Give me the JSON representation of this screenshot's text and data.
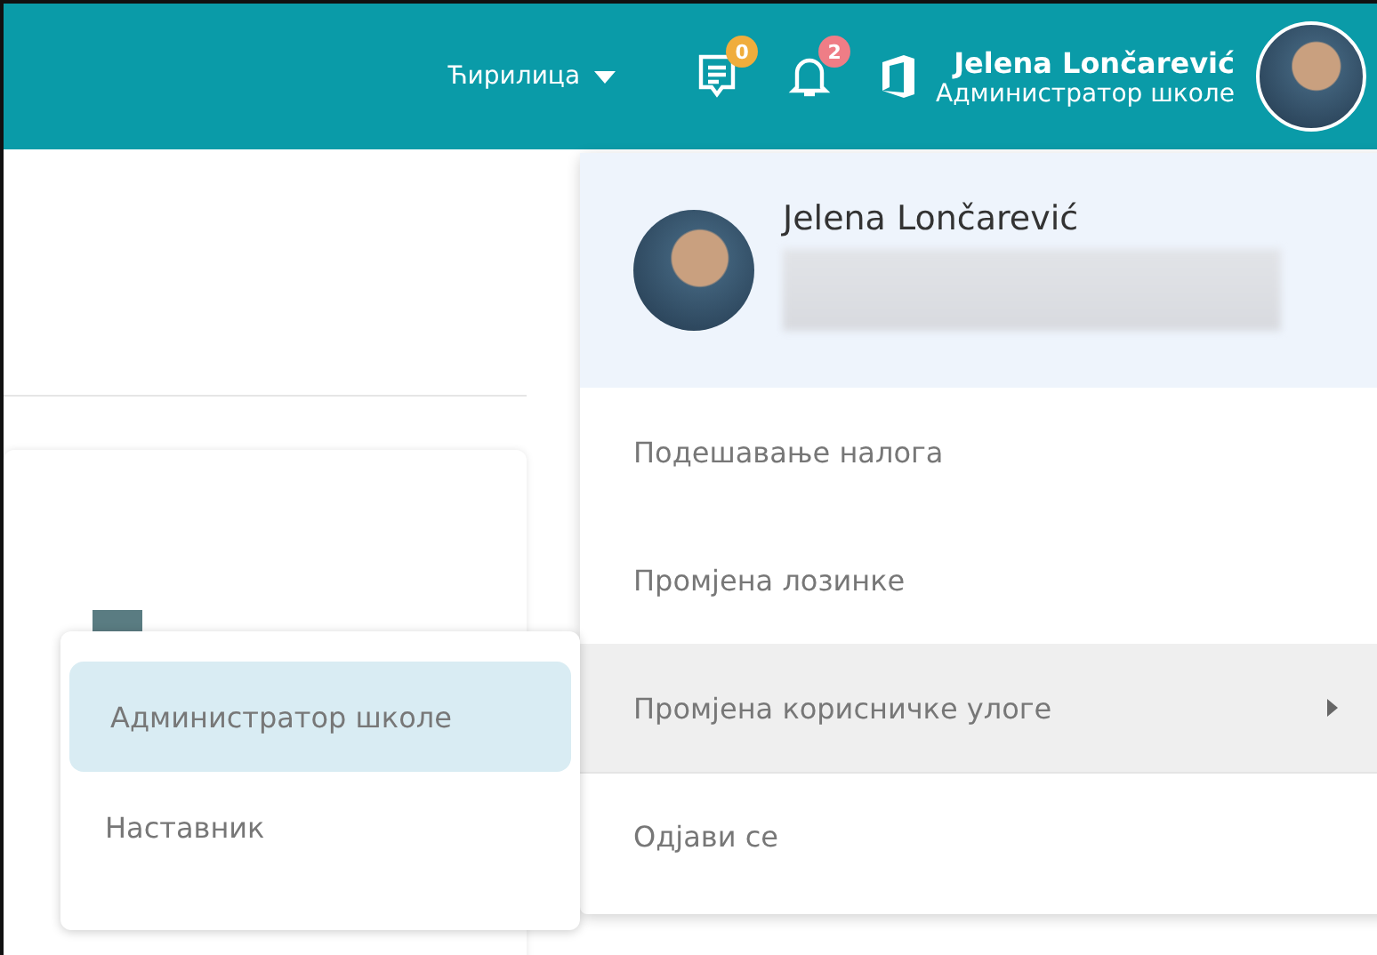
{
  "header": {
    "language": "Ћирилица",
    "messages_badge": "0",
    "notifications_badge": "2",
    "user_name": "Jelena Lončarević",
    "user_role": "Администратор школе"
  },
  "account_menu": {
    "name": "Jelena Lončarević",
    "items": [
      {
        "label": "Подешавање налога",
        "kind": "link",
        "highlighted": false
      },
      {
        "label": "Промјена лозинке",
        "kind": "link",
        "highlighted": false
      },
      {
        "label": "Промјена корисничке улоге",
        "kind": "submenu",
        "highlighted": true
      },
      {
        "label": "Одјави се",
        "kind": "link",
        "highlighted": false
      }
    ]
  },
  "role_menu": [
    {
      "label": "Администратор школе",
      "selected": true
    },
    {
      "label": "Наставник",
      "selected": false
    }
  ]
}
